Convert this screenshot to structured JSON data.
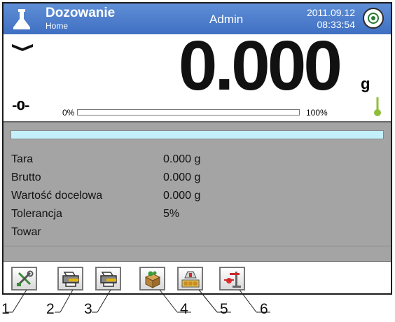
{
  "header": {
    "title": "Dozowanie",
    "subtitle": "Home",
    "user": "Admin",
    "date": "2011.09.12",
    "time": "08:33:54"
  },
  "display": {
    "zero_indicator": "-0-",
    "weight": "0.000",
    "unit": "g",
    "progress_min": "0%",
    "progress_max": "100%",
    "progress_value": 0
  },
  "info": {
    "rows": [
      {
        "label": "Tara",
        "value": "0.000 g"
      },
      {
        "label": "Brutto",
        "value": "0.000 g"
      },
      {
        "label": "Wartość docelowa",
        "value": "0.000 g"
      },
      {
        "label": "Tolerancja",
        "value": "5%"
      },
      {
        "label": "Towar",
        "value": ""
      }
    ]
  },
  "toolbar": {
    "buttons": [
      {
        "icon": "settings-tools-icon"
      },
      {
        "icon": "printer-icon"
      },
      {
        "icon": "printer-icon"
      },
      {
        "icon": "product-box-icon"
      },
      {
        "icon": "tare-icon"
      },
      {
        "icon": "dosing-icon"
      }
    ]
  },
  "callouts": [
    "1",
    "2",
    "3",
    "4",
    "5",
    "6"
  ],
  "colors": {
    "header": "#4a7ccb",
    "info_panel": "#a4a4a4",
    "info_bar": "#c4f0fb"
  }
}
